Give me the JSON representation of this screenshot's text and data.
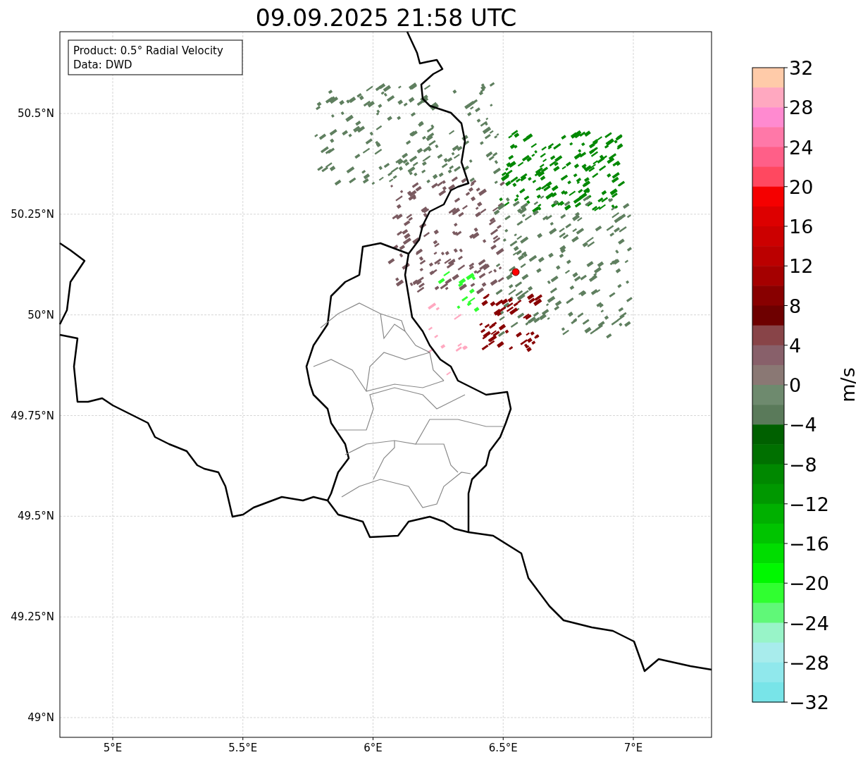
{
  "title": "09.09.2025 21:58 UTC",
  "info_box": {
    "lines": [
      "Product: 0.5° Radial Velocity",
      "Data: DWD"
    ]
  },
  "map": {
    "longitude_labels": [
      "5°E",
      "5.5°E",
      "6°E",
      "6.5°E",
      "7°E"
    ],
    "latitude_labels": [
      "50.5°N",
      "50.25°N",
      "50°N",
      "49.75°N",
      "49.5°N",
      "49.25°N",
      "49°N"
    ]
  },
  "colorbar": {
    "label": "m/s",
    "tick_labels": [
      "32",
      "28",
      "24",
      "20",
      "16",
      "12",
      "8",
      "4",
      "0",
      "−4",
      "−8",
      "−12",
      "−16",
      "−20",
      "−24",
      "−28",
      "−32"
    ],
    "bins": [
      {
        "color": "#ffcba9"
      },
      {
        "color": "#ffa8c0"
      },
      {
        "color": "#ff8ad0"
      },
      {
        "color": "#ff78a8"
      },
      {
        "color": "#ff5f88"
      },
      {
        "color": "#ff4860"
      },
      {
        "color": "#f50000"
      },
      {
        "color": "#dd0000"
      },
      {
        "color": "#cc0000"
      },
      {
        "color": "#bb0000"
      },
      {
        "color": "#a50000"
      },
      {
        "color": "#880000"
      },
      {
        "color": "#6e0000"
      },
      {
        "color": "#884448"
      },
      {
        "color": "#88606a"
      },
      {
        "color": "#8a7874"
      },
      {
        "color": "#6e8a6e"
      },
      {
        "color": "#5a7a5a"
      },
      {
        "color": "#006000"
      },
      {
        "color": "#007000"
      },
      {
        "color": "#008800"
      },
      {
        "color": "#009800"
      },
      {
        "color": "#00b000"
      },
      {
        "color": "#00c400"
      },
      {
        "color": "#00dd00"
      },
      {
        "color": "#00f800"
      },
      {
        "color": "#30ff30"
      },
      {
        "color": "#60f878"
      },
      {
        "color": "#98f4c8"
      },
      {
        "color": "#a8ecec"
      },
      {
        "color": "#90e8ec"
      },
      {
        "color": "#78e4e8"
      }
    ]
  }
}
